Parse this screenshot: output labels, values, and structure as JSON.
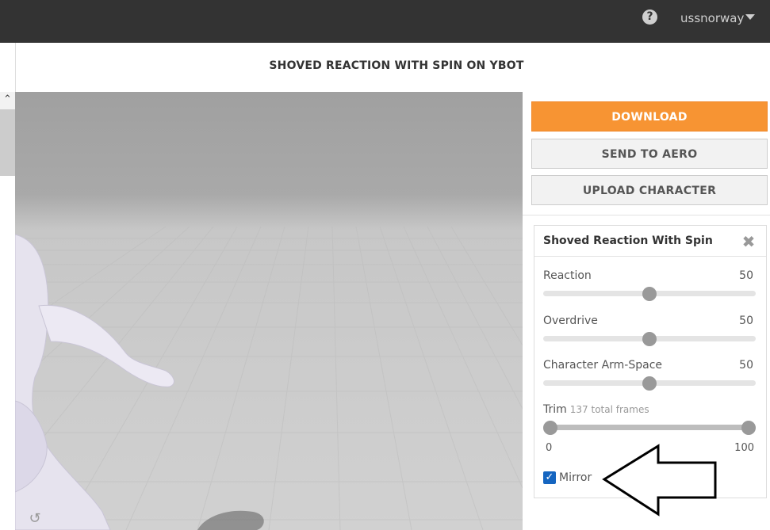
{
  "header": {
    "help_icon": "question-circle-icon",
    "help_glyph": "?",
    "username": "ussnorway"
  },
  "title": "SHOVED REACTION WITH SPIN ON YBOT",
  "actions": {
    "download": "DOWNLOAD",
    "send_to_aero": "SEND TO AERO",
    "upload_character": "UPLOAD CHARACTER"
  },
  "panel": {
    "title": "Shoved Reaction With Spin",
    "params": [
      {
        "label": "Reaction",
        "value": "50"
      },
      {
        "label": "Overdrive",
        "value": "50"
      },
      {
        "label": "Character Arm-Space",
        "value": "50"
      }
    ],
    "trim": {
      "label": "Trim",
      "note": "137 total frames",
      "min": "0",
      "max": "100"
    },
    "mirror": {
      "label": "Mirror",
      "checked": true
    }
  },
  "colors": {
    "accent": "#f79433",
    "topbar": "#333333",
    "checkbox": "#1565c0"
  }
}
